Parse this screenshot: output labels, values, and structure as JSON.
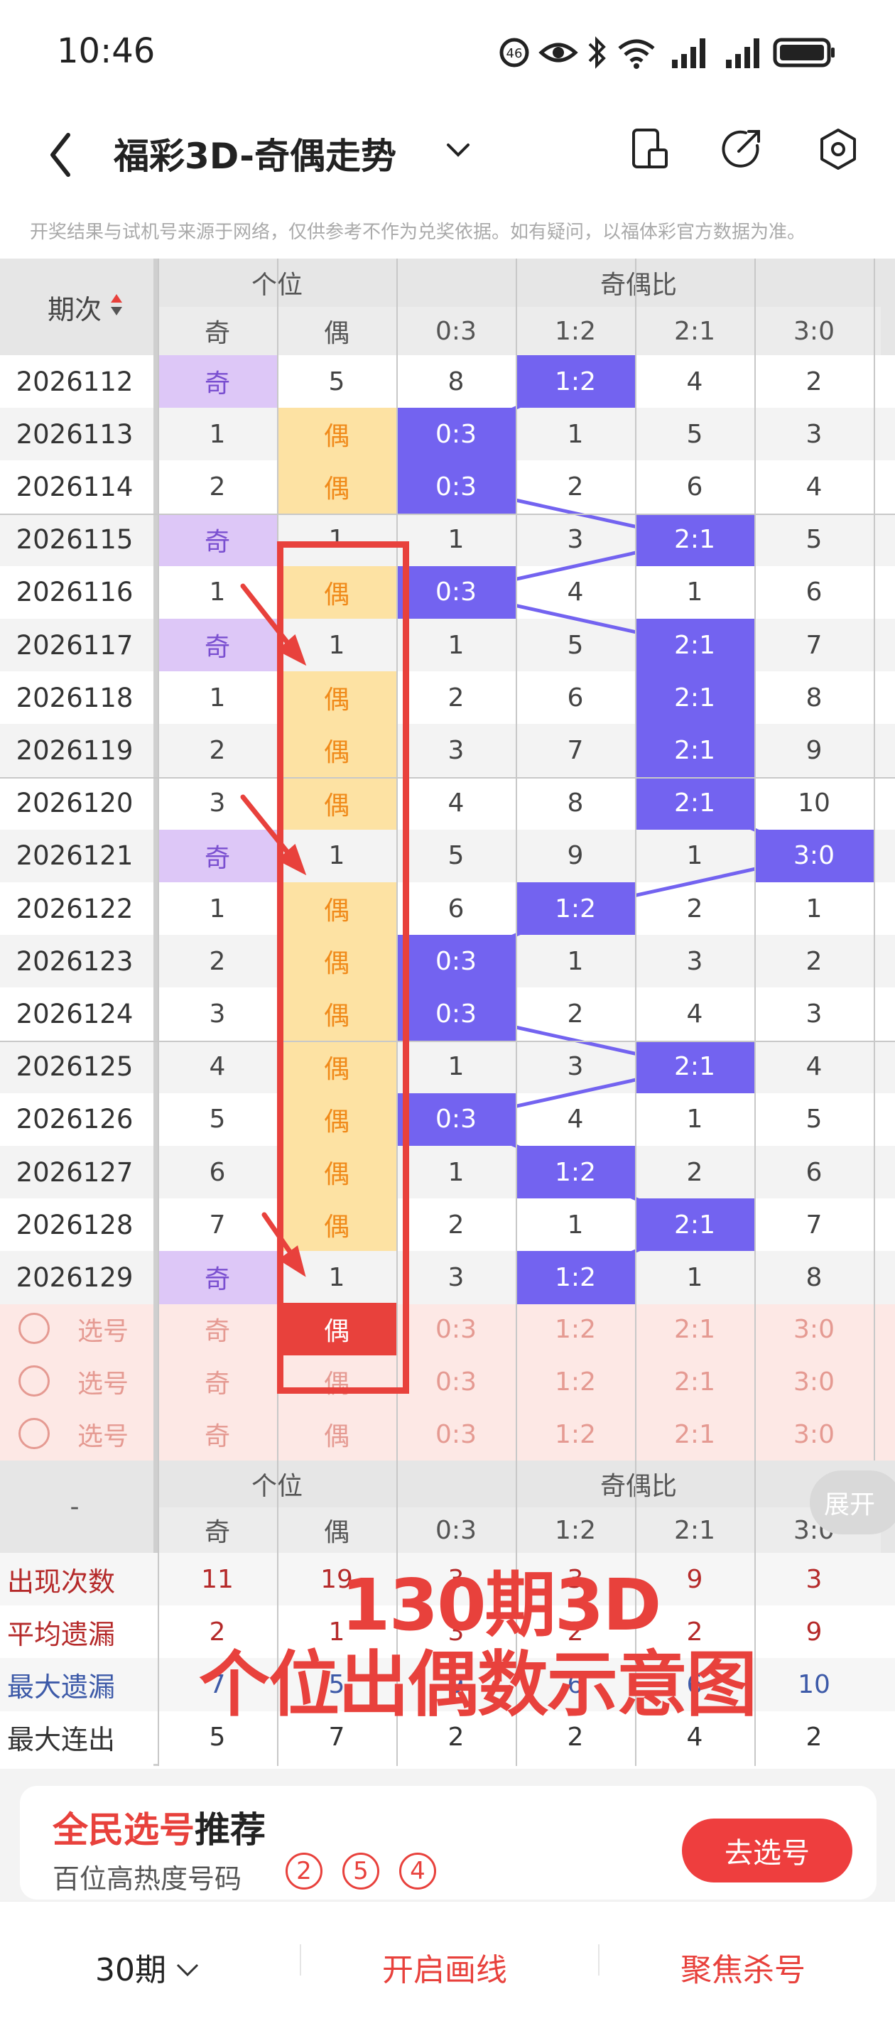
{
  "status": {
    "time": "10:46",
    "signal": "6"
  },
  "header": {
    "title": "福彩3D-奇偶走势"
  },
  "disclaimer": "开奖结果与试机号来源于网络，仅供参考不作为兑奖依据。如有疑问，以福体彩官方数据为准。",
  "table": {
    "period_header": "期次",
    "group_position": "个位",
    "group_ratio": "奇偶比",
    "sub_headers": [
      "奇",
      "偶",
      "0:3",
      "1:2",
      "2:1",
      "3:0"
    ],
    "rows": [
      {
        "p": "2026112",
        "c": [
          "奇",
          "5",
          "8",
          "1:2",
          "4",
          "2"
        ]
      },
      {
        "p": "2026113",
        "c": [
          "1",
          "偶",
          "0:3",
          "1",
          "5",
          "3"
        ]
      },
      {
        "p": "2026114",
        "c": [
          "2",
          "偶",
          "0:3",
          "2",
          "6",
          "4"
        ]
      },
      {
        "p": "2026115",
        "c": [
          "奇",
          "1",
          "1",
          "3",
          "2:1",
          "5"
        ]
      },
      {
        "p": "2026116",
        "c": [
          "1",
          "偶",
          "0:3",
          "4",
          "1",
          "6"
        ]
      },
      {
        "p": "2026117",
        "c": [
          "奇",
          "1",
          "1",
          "5",
          "2:1",
          "7"
        ]
      },
      {
        "p": "2026118",
        "c": [
          "1",
          "偶",
          "2",
          "6",
          "2:1",
          "8"
        ]
      },
      {
        "p": "2026119",
        "c": [
          "2",
          "偶",
          "3",
          "7",
          "2:1",
          "9"
        ]
      },
      {
        "p": "2026120",
        "c": [
          "3",
          "偶",
          "4",
          "8",
          "2:1",
          "10"
        ]
      },
      {
        "p": "2026121",
        "c": [
          "奇",
          "1",
          "5",
          "9",
          "1",
          "3:0"
        ]
      },
      {
        "p": "2026122",
        "c": [
          "1",
          "偶",
          "6",
          "1:2",
          "2",
          "1"
        ]
      },
      {
        "p": "2026123",
        "c": [
          "2",
          "偶",
          "0:3",
          "1",
          "3",
          "2"
        ]
      },
      {
        "p": "2026124",
        "c": [
          "3",
          "偶",
          "0:3",
          "2",
          "4",
          "3"
        ]
      },
      {
        "p": "2026125",
        "c": [
          "4",
          "偶",
          "1",
          "3",
          "2:1",
          "4"
        ]
      },
      {
        "p": "2026126",
        "c": [
          "5",
          "偶",
          "0:3",
          "4",
          "1",
          "5"
        ]
      },
      {
        "p": "2026127",
        "c": [
          "6",
          "偶",
          "1",
          "1:2",
          "2",
          "6"
        ]
      },
      {
        "p": "2026128",
        "c": [
          "7",
          "偶",
          "2",
          "1",
          "2:1",
          "7"
        ]
      },
      {
        "p": "2026129",
        "c": [
          "奇",
          "1",
          "3",
          "1:2",
          "1",
          "8"
        ]
      }
    ],
    "pick_rows": [
      {
        "label": "选号",
        "c": [
          "奇",
          "偶",
          "0:3",
          "1:2",
          "2:1",
          "3:0"
        ]
      },
      {
        "label": "选号",
        "c": [
          "奇",
          "偶",
          "0:3",
          "1:2",
          "2:1",
          "3:0"
        ]
      },
      {
        "label": "选号",
        "c": [
          "奇",
          "偶",
          "0:3",
          "1:2",
          "2:1",
          "3:0"
        ]
      }
    ]
  },
  "stats": {
    "dash": "-",
    "expand": "展开",
    "rows": [
      {
        "label": "出现次数",
        "c": [
          "11",
          "19",
          "3",
          "3",
          "9",
          "3"
        ],
        "color": "#b52a2a"
      },
      {
        "label": "平均遗漏",
        "c": [
          "2",
          "1",
          "3",
          "2",
          "2",
          "9"
        ],
        "color": "#b52a2a"
      },
      {
        "label": "最大遗漏",
        "c": [
          "7",
          "5",
          "9",
          "6",
          "6",
          "10"
        ],
        "color": "#3d5aa8"
      },
      {
        "label": "最大连出",
        "c": [
          "5",
          "7",
          "2",
          "2",
          "4",
          "2"
        ],
        "color": "#333333"
      }
    ]
  },
  "overlay": {
    "line1": "130期3D",
    "line2": "个位出偶数示意图"
  },
  "recommend": {
    "title_red": "全民选号",
    "title_black": "推荐",
    "subtitle": "百位高热度号码",
    "balls": [
      "2",
      "5",
      "4"
    ],
    "button": "去选号"
  },
  "bottom": {
    "periods": "30期",
    "draw": "开启画线",
    "kill": "聚焦杀号"
  },
  "colors": {
    "odd_bg": "#ddc7f7",
    "odd_text": "#7a4fd0",
    "even_bg": "#fde2a3",
    "even_text": "#f08a1a",
    "ratio_bg": "#7363f0",
    "red": "#e8413c"
  }
}
